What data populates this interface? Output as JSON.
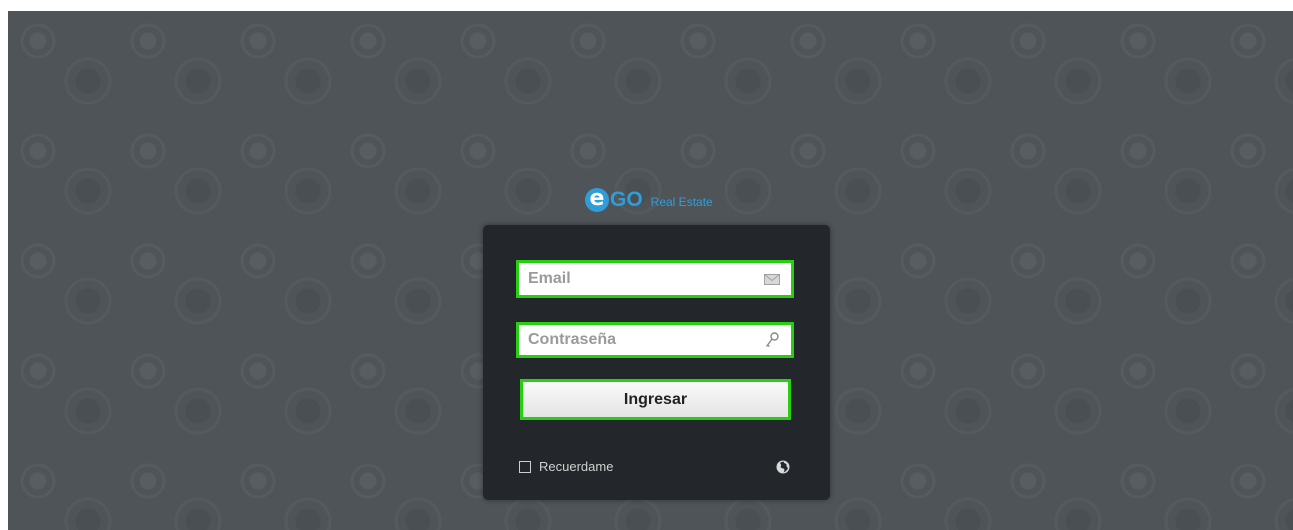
{
  "brand": {
    "logo_e": "e",
    "logo_go": "GO",
    "tagline": "Real Estate",
    "accent_color": "#2f9ed8"
  },
  "login": {
    "email_placeholder": "Email",
    "email_icon": "envelope-icon",
    "password_placeholder": "Contraseña",
    "password_icon": "key-icon",
    "submit_label": "Ingresar",
    "remember_label": "Recuerdame",
    "remember_checked": false,
    "language_icon": "globe-icon",
    "highlight_color": "#26d00e"
  }
}
